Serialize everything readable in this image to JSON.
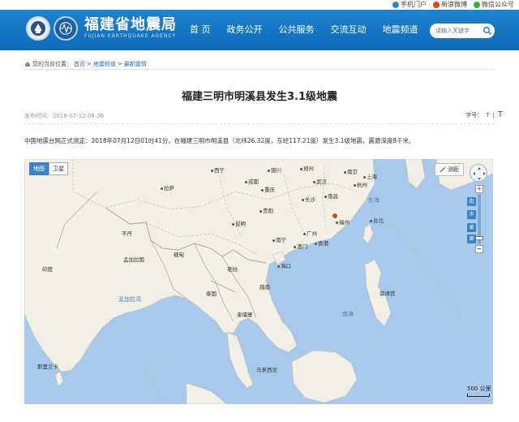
{
  "topbar": {
    "links": [
      {
        "label": "手机门户",
        "icon": "phone-icon",
        "color": "#3b7fc4"
      },
      {
        "label": "新浪微博",
        "icon": "weibo-icon",
        "color": "#e0402a"
      },
      {
        "label": "微信公众号",
        "icon": "wechat-icon",
        "color": "#3cb034"
      }
    ]
  },
  "header": {
    "site_name": "福建省地震局",
    "site_name_en": "FUJIAN EARTHQUAKE AGENCY",
    "nav": [
      "首 页",
      "政务公开",
      "公共服务",
      "交流互动",
      "地震频道"
    ],
    "search_placeholder": "请输入关键字",
    "brand_color": "#1477c6"
  },
  "breadcrumb": {
    "prefix": "您的当前位置：",
    "items": [
      "首页",
      "地震频道",
      "最新震情"
    ],
    "separator": ">"
  },
  "article": {
    "title": "福建三明市明溪县发生3.1级地震",
    "publish_time": "发布时间：2018-07-12 08:36",
    "font_size_label": "字号：",
    "font_small": "T",
    "font_big": "T",
    "body": "中国地震台网正式测定：2018年07月12日01时41分，在福建三明市明溪县（北纬26.32度，东经117.21度）发生3.1级地震，震源深度8千米。"
  },
  "map": {
    "tabs": [
      "地图",
      "卫星"
    ],
    "ruler_label": "测距",
    "zoom_levels": [
      "街",
      "市",
      "省",
      "国"
    ],
    "scale_label": "500 公里",
    "epicenter_color": "#e03a2a",
    "labels": {
      "cities": [
        "成都",
        "重庆",
        "武汉",
        "南京",
        "上海",
        "杭州",
        "长沙",
        "南昌",
        "福州",
        "贵阳",
        "昆明",
        "广州",
        "香港",
        "澳门",
        "南宁",
        "海口",
        "台北",
        "拉萨",
        "西宁",
        "银川",
        "郑州"
      ],
      "seas": [
        "东海",
        "南海",
        "孟加拉湾"
      ],
      "countries": [
        "印度",
        "缅甸",
        "老挝",
        "泰国",
        "越南",
        "柬埔寨",
        "菲律宾",
        "马来西亚",
        "斯里兰卡",
        "不丹",
        "孟加拉国"
      ]
    }
  }
}
